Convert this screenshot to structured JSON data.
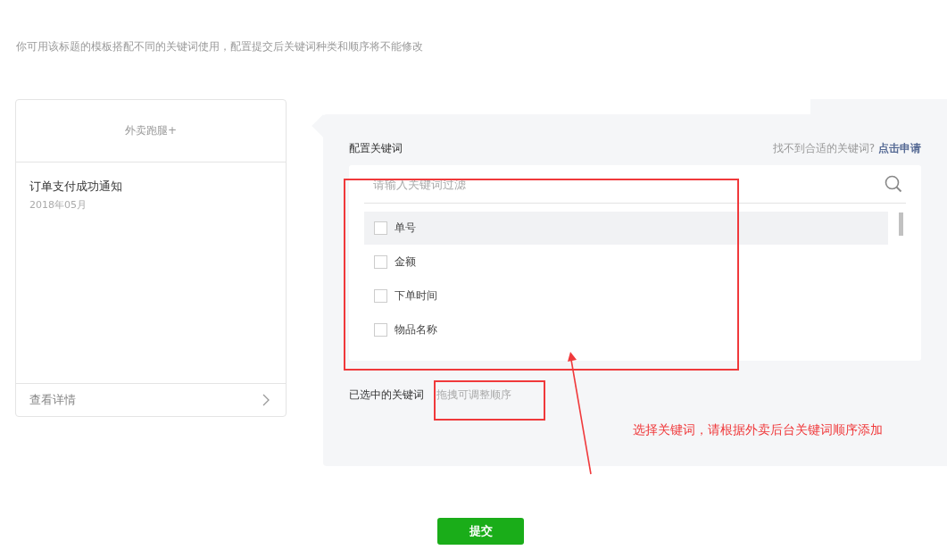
{
  "description": "你可用该标题的模板搭配不同的关键词使用，配置提交后关键词种类和顺序将不能修改",
  "template_card": {
    "brand": "外卖跑腿+",
    "title": "订单支付成功通知",
    "date": "2018年05月",
    "details_link": "查看详情"
  },
  "config": {
    "heading": "配置关键词",
    "hint": "找不到合适的关键词?",
    "apply_link": "点击申请",
    "filter_placeholder": "请输入关键词过滤",
    "keywords": [
      {
        "label": "单号",
        "checked": false,
        "hovered": true
      },
      {
        "label": "金额",
        "checked": false,
        "hovered": false
      },
      {
        "label": "下单时间",
        "checked": false,
        "hovered": false
      },
      {
        "label": "物品名称",
        "checked": false,
        "hovered": false
      }
    ],
    "selected_label": "已选中的关键词",
    "selected_placeholder": "拖拽可调整顺序"
  },
  "annotation": "选择关键词，请根据外卖后台关键词顺序添加",
  "submit_button": "提交"
}
